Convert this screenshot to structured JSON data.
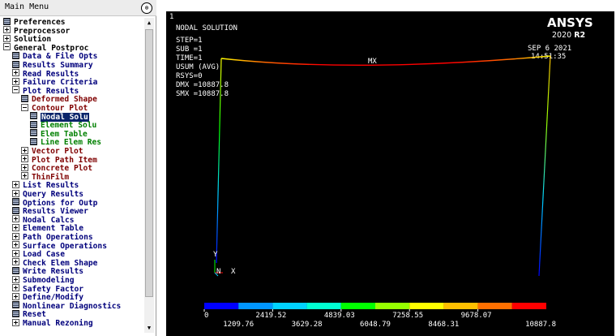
{
  "menu": {
    "title": "Main Menu",
    "collapse_glyph": "⊗",
    "items": [
      {
        "label": "Preferences",
        "icon": "book",
        "color": "black",
        "level": 0
      },
      {
        "label": "Preprocessor",
        "icon": "plus",
        "color": "black",
        "level": 0
      },
      {
        "label": "Solution",
        "icon": "plus",
        "color": "black",
        "level": 0
      },
      {
        "label": "General Postproc",
        "icon": "minus",
        "color": "black",
        "level": 0
      },
      {
        "label": "Data & File Opts",
        "icon": "book",
        "color": "navy",
        "level": 1
      },
      {
        "label": "Results Summary",
        "icon": "book",
        "color": "navy",
        "level": 1
      },
      {
        "label": "Read Results",
        "icon": "plus",
        "color": "navy",
        "level": 1
      },
      {
        "label": "Failure Criteria",
        "icon": "plus",
        "color": "navy",
        "level": 1
      },
      {
        "label": "Plot Results",
        "icon": "minus",
        "color": "navy",
        "level": 1
      },
      {
        "label": "Deformed Shape",
        "icon": "book",
        "color": "maroon",
        "level": 2
      },
      {
        "label": "Contour Plot",
        "icon": "minus",
        "color": "maroon",
        "level": 2
      },
      {
        "label": "Nodal Solu",
        "icon": "book",
        "color": "green",
        "level": 3,
        "selected": true
      },
      {
        "label": "Element Solu",
        "icon": "book",
        "color": "green",
        "level": 3
      },
      {
        "label": "Elem Table",
        "icon": "book",
        "color": "green",
        "level": 3
      },
      {
        "label": "Line Elem Res",
        "icon": "book",
        "color": "green",
        "level": 3
      },
      {
        "label": "Vector Plot",
        "icon": "plus",
        "color": "maroon",
        "level": 2
      },
      {
        "label": "Plot Path Item",
        "icon": "plus",
        "color": "maroon",
        "level": 2
      },
      {
        "label": "Concrete Plot",
        "icon": "plus",
        "color": "maroon",
        "level": 2
      },
      {
        "label": "ThinFilm",
        "icon": "plus",
        "color": "maroon",
        "level": 2
      },
      {
        "label": "List Results",
        "icon": "plus",
        "color": "navy",
        "level": 1
      },
      {
        "label": "Query Results",
        "icon": "plus",
        "color": "navy",
        "level": 1
      },
      {
        "label": "Options for Outp",
        "icon": "book",
        "color": "navy",
        "level": 1
      },
      {
        "label": "Results Viewer",
        "icon": "book",
        "color": "navy",
        "level": 1
      },
      {
        "label": "Nodal Calcs",
        "icon": "plus",
        "color": "navy",
        "level": 1
      },
      {
        "label": "Element Table",
        "icon": "plus",
        "color": "navy",
        "level": 1
      },
      {
        "label": "Path Operations",
        "icon": "plus",
        "color": "navy",
        "level": 1
      },
      {
        "label": "Surface Operations",
        "icon": "plus",
        "color": "navy",
        "level": 1
      },
      {
        "label": "Load Case",
        "icon": "plus",
        "color": "navy",
        "level": 1
      },
      {
        "label": "Check Elem Shape",
        "icon": "plus",
        "color": "navy",
        "level": 1
      },
      {
        "label": "Write Results",
        "icon": "book",
        "color": "navy",
        "level": 1
      },
      {
        "label": "Submodeling",
        "icon": "plus",
        "color": "navy",
        "level": 1
      },
      {
        "label": "Safety Factor",
        "icon": "plus",
        "color": "navy",
        "level": 1
      },
      {
        "label": "Define/Modify",
        "icon": "plus",
        "color": "navy",
        "level": 1
      },
      {
        "label": "Nonlinear Diagnostics",
        "icon": "book",
        "color": "navy",
        "level": 1
      },
      {
        "label": "Reset",
        "icon": "book",
        "color": "navy",
        "level": 1
      },
      {
        "label": "Manual Rezoning",
        "icon": "plus",
        "color": "navy",
        "level": 1
      }
    ],
    "colors": {
      "black": "#000000",
      "navy": "#00007c",
      "maroon": "#7f0000",
      "green": "#008000"
    }
  },
  "graphics": {
    "window_number": "1",
    "solution_title": "NODAL SOLUTION",
    "info_lines": [
      "STEP=1",
      "SUB =1",
      "TIME=1",
      "USUM    (AVG)",
      "RSYS=0",
      "DMX =10887.8",
      "SMX =10887.8"
    ],
    "max_label": "MX",
    "date": "SEP  6 2021",
    "time": "14:51:35",
    "logo_name": "ANSYS",
    "logo_version_prefix": "2020 ",
    "logo_version_suffix": "R2",
    "triad": {
      "y_label": "Y",
      "x_label": "X",
      "n_label": "N"
    },
    "legend": {
      "upper_labels": [
        "0",
        "2419.52",
        "4839.03",
        "7258.55",
        "9678.07"
      ],
      "lower_labels": [
        "1209.76",
        "3629.28",
        "6048.79",
        "8468.31",
        "10887.8"
      ],
      "band_colors": [
        "#0000ff",
        "#0096ff",
        "#00d2ff",
        "#00ffd2",
        "#00ff00",
        "#96ff00",
        "#ffff00",
        "#ffc000",
        "#ff7000",
        "#ff0000"
      ]
    }
  }
}
